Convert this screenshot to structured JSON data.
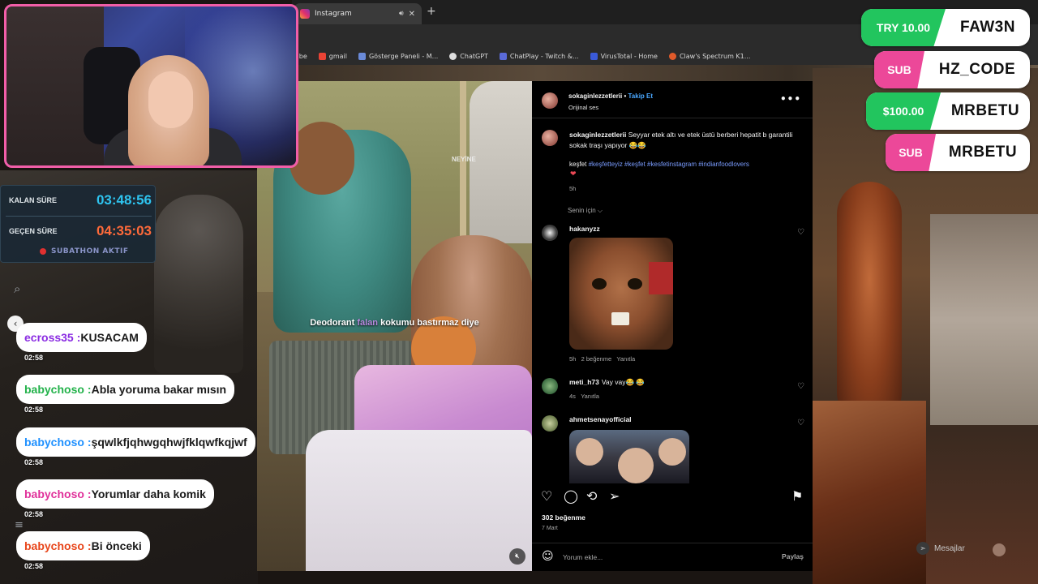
{
  "browser": {
    "tab_title": "Instagram",
    "tab_sound_icon": "speaker-icon",
    "tab_close": "✕",
    "new_tab": "+",
    "bookmarks": [
      {
        "label": "Tube",
        "color": "#ff0000"
      },
      {
        "label": "gmail",
        "color": "#ea4335"
      },
      {
        "label": "Gösterge Paneli - M...",
        "color": "#6a8ad8"
      },
      {
        "label": "ChatGPT",
        "color": "#dddddd"
      },
      {
        "label": "ChatPlay - Twitch &...",
        "color": "#5a6ad8"
      },
      {
        "label": "VirusTotal - Home",
        "color": "#3a5ad8"
      },
      {
        "label": "Claw's Spectrum K1...",
        "color": "#e05a2a"
      }
    ]
  },
  "timer": {
    "remaining_label": "KALAN SÜRE",
    "remaining_value": "03:48:56",
    "remaining_color": "#2ec4f0",
    "elapsed_label": "GEÇEN SÜRE",
    "elapsed_value": "04:35:03",
    "elapsed_color": "#ff6a3a",
    "status": "SUBATHON AKTIF"
  },
  "chat": {
    "collapse_icon": "‹",
    "messages": [
      {
        "user": "ecross35",
        "sep": " : ",
        "text": "KUSACAM",
        "color": "#8a2be2",
        "time": "02:58"
      },
      {
        "user": "babychoso",
        "sep": " : ",
        "text": "Abla yoruma bakar mısın",
        "color": "#22b24a",
        "time": "02:58"
      },
      {
        "user": "babychoso",
        "sep": " : ",
        "text": "şqwlkfjqhwgqhwjfklqwfkqjwf",
        "color": "#1e90ff",
        "time": "02:58"
      },
      {
        "user": "babychoso",
        "sep": " : ",
        "text": "Yorumlar daha komik",
        "color": "#e0309a",
        "time": "02:58"
      },
      {
        "user": "babychoso",
        "sep": " : ",
        "text": "Bi önceki",
        "color": "#e8451a",
        "time": "02:58"
      }
    ]
  },
  "donations": [
    {
      "tag": "TRY 10.00",
      "name": "FAW3N",
      "color": "#22c55e"
    },
    {
      "tag": "SUB",
      "name": "HZ_CODE",
      "color": "#ec4899"
    },
    {
      "tag": "$100.00",
      "name": "MRBETU",
      "color": "#22c55e"
    },
    {
      "tag": "SUB",
      "name": "MRBETU",
      "color": "#ec4899"
    }
  ],
  "video": {
    "caption_a": "Deodorant ",
    "caption_b": "falan",
    "caption_c": " kokumu bastırmaz diye",
    "watermark": "NEYİNE",
    "mute_icon": "volume-off-icon"
  },
  "post": {
    "author": "sokaginlezzetlerii",
    "dot": " • ",
    "follow": "Takip Et",
    "audio": "Orijinal ses",
    "more": "•••",
    "caption_author": "sokaginlezzetlerii",
    "caption_text": " Seyyar etek altı ve etek üstü berberi hepatit b garantili sokak traşı yapıyor 😂😂",
    "tags_lead": "keşfet ",
    "tags": "#keşfetteyiz #keşfet #kesfetinstagram #indianfoodlovers",
    "heart": "❤",
    "caption_age": "5h",
    "for_you": "Senin için ⌵",
    "comments": [
      {
        "user": "hakanyzz",
        "text": "",
        "age": "5h",
        "likes": "2 beğenme",
        "reply": "Yanıtla"
      },
      {
        "user": "meti_h73",
        "text": "Vay vay😂 😂",
        "age": "4s",
        "likes": "",
        "reply": "Yanıtla"
      },
      {
        "user": "ahmetsenayofficial",
        "text": "",
        "age": "",
        "likes": "",
        "reply": ""
      }
    ],
    "likes_count": "302 beğenme",
    "date": "7 Mart",
    "comment_placeholder": "Yorum ekle...",
    "share": "Paylaş"
  },
  "footer": {
    "messages": "Mesajlar"
  }
}
